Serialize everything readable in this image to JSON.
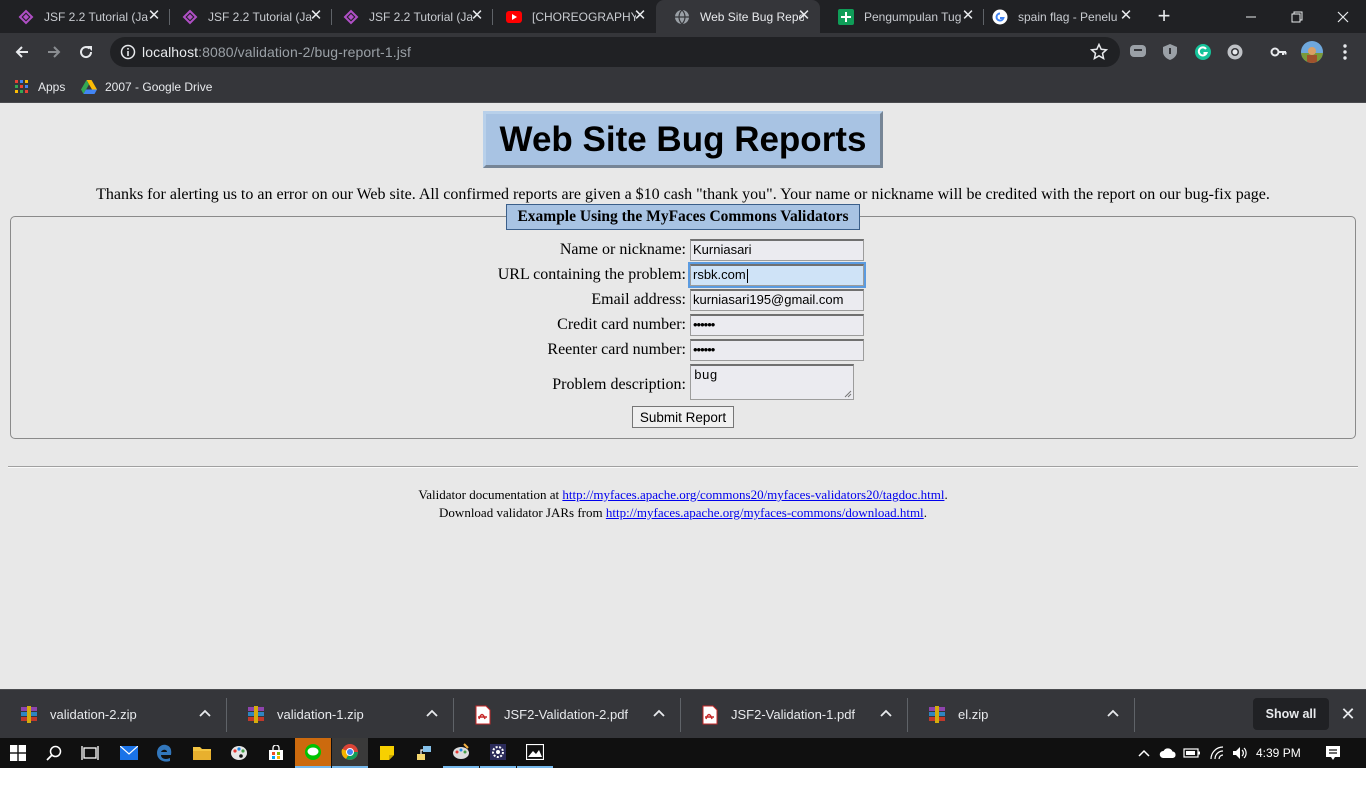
{
  "browser": {
    "tabs": [
      {
        "title": "JSF 2.2 Tutorial (Ja",
        "icon": "jsf-favicon",
        "active": false
      },
      {
        "title": "JSF 2.2 Tutorial (Ja",
        "icon": "jsf-favicon",
        "active": false
      },
      {
        "title": "JSF 2.2 Tutorial (Ja",
        "icon": "jsf-favicon",
        "active": false
      },
      {
        "title": "[CHOREOGRAPHY",
        "icon": "youtube-favicon",
        "active": false
      },
      {
        "title": "Web Site Bug Repo",
        "icon": "globe-favicon",
        "active": true
      },
      {
        "title": "Pengumpulan Tug",
        "icon": "google-classroom-favicon",
        "active": false
      },
      {
        "title": "spain flag - Penelu",
        "icon": "google-favicon",
        "active": false
      }
    ],
    "address": {
      "host": "localhost",
      "rest": ":8080/validation-2/bug-report-1.jsf"
    },
    "bookmarks": [
      {
        "label": "Apps",
        "icon": "apps-grid-icon"
      },
      {
        "label": "2007 - Google Drive",
        "icon": "google-drive-icon"
      }
    ]
  },
  "page": {
    "title": "Web Site Bug Reports",
    "intro": "Thanks for alerting us to an error on our Web site. All confirmed reports are given a $10 cash \"thank you\". Your name or nickname will be credited with the report on our bug-fix page.",
    "legend": "Example Using the MyFaces Commons Validators",
    "form": {
      "name": {
        "label": "Name or nickname:",
        "value": "Kurniasari"
      },
      "url": {
        "label": "URL containing the problem:",
        "value": "rsbk.com"
      },
      "email": {
        "label": "Email address:",
        "value": "kurniasari195@gmail.com"
      },
      "card": {
        "label": "Credit card number:",
        "value": "••••••"
      },
      "card2": {
        "label": "Reenter card number:",
        "value": "••••••"
      },
      "description": {
        "label": "Problem description:",
        "value": "bug"
      },
      "submit": "Submit Report"
    },
    "footer": {
      "line1_prefix": "Validator documentation at ",
      "line1_link": "http://myfaces.apache.org/commons20/myfaces-validators20/tagdoc.html",
      "line2_prefix": "Download validator JARs from ",
      "line2_link": "http://myfaces.apache.org/myfaces-commons/download.html",
      "period": "."
    }
  },
  "downloads": {
    "items": [
      {
        "name": "validation-2.zip",
        "icon": "winrar-icon"
      },
      {
        "name": "validation-1.zip",
        "icon": "winrar-icon"
      },
      {
        "name": "JSF2-Validation-2.pdf",
        "icon": "pdf-icon"
      },
      {
        "name": "JSF2-Validation-1.pdf",
        "icon": "pdf-icon"
      },
      {
        "name": "el.zip",
        "icon": "winrar-icon"
      }
    ],
    "show_all": "Show all"
  },
  "taskbar": {
    "clock": "4:39 PM"
  },
  "colors": {
    "page_bg": "#e8e8e8",
    "banner_bg": "#a8c3e3",
    "link": "#0000ee",
    "chrome_dark": "#202124",
    "chrome_toolbar": "#35363a"
  }
}
